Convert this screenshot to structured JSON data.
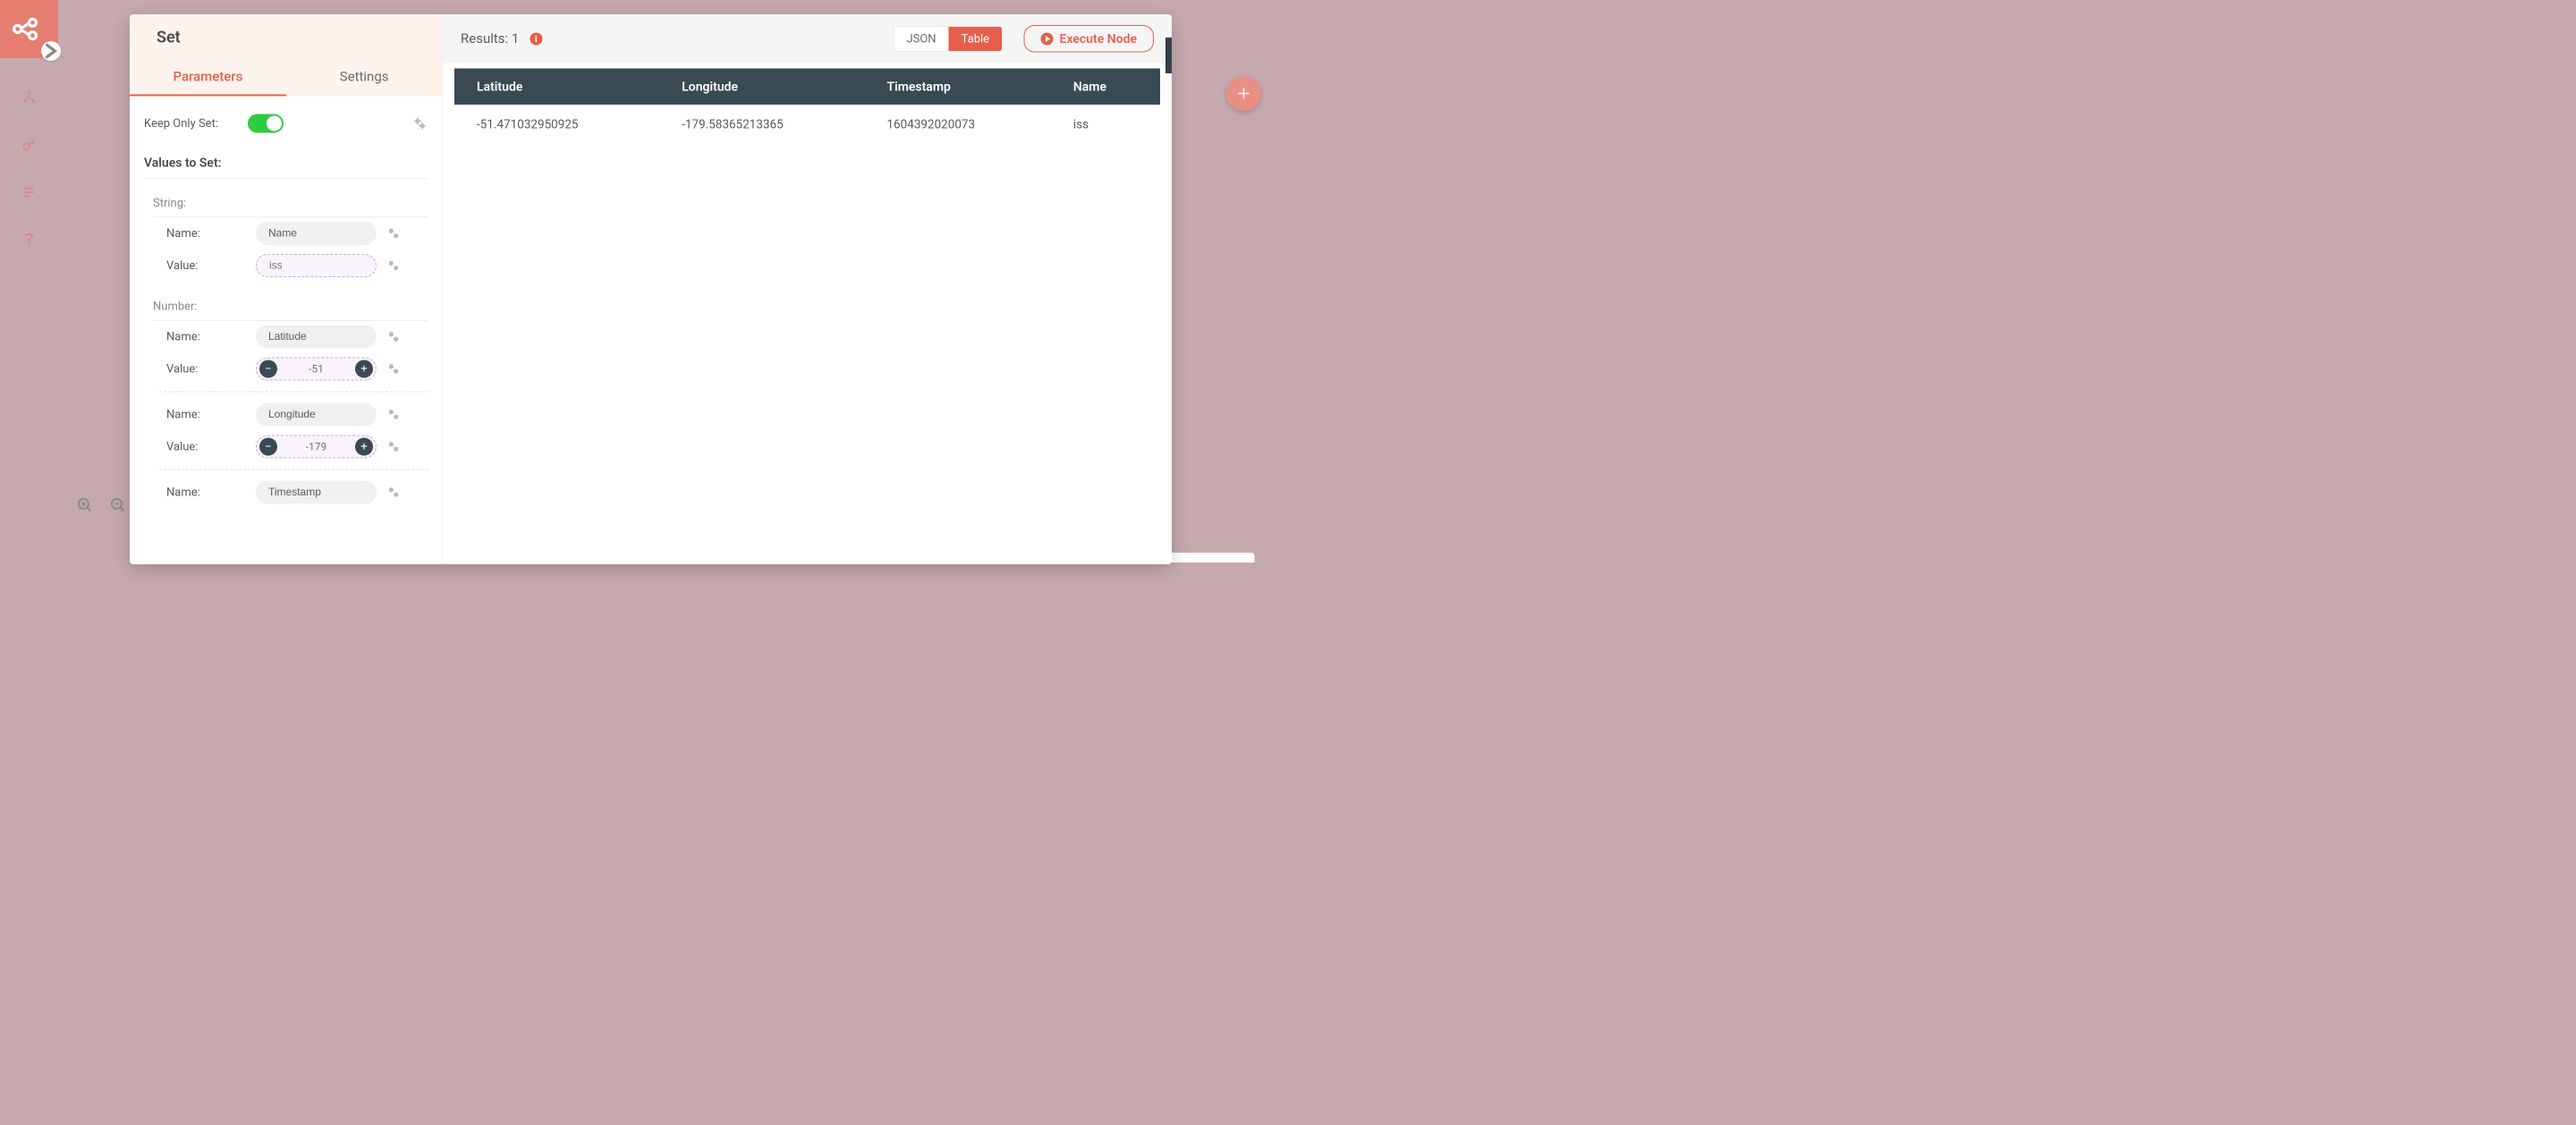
{
  "node": {
    "title": "Set"
  },
  "tabs": {
    "parameters": "Parameters",
    "settings": "Settings"
  },
  "params": {
    "keepOnlySet": {
      "label": "Keep Only Set:",
      "value": true
    },
    "valuesToSet": {
      "label": "Values to Set:"
    },
    "string": {
      "section": "String:",
      "items": [
        {
          "nameLabel": "Name:",
          "name": "Name",
          "valueLabel": "Value:",
          "value": "iss"
        }
      ]
    },
    "number": {
      "section": "Number:",
      "items": [
        {
          "nameLabel": "Name:",
          "name": "Latitude",
          "valueLabel": "Value:",
          "value": "-51"
        },
        {
          "nameLabel": "Name:",
          "name": "Longitude",
          "valueLabel": "Value:",
          "value": "-179"
        },
        {
          "nameLabel": "Name:",
          "name": "Timestamp"
        }
      ]
    }
  },
  "results": {
    "label": "Results: 1",
    "viewJSON": "JSON",
    "viewTable": "Table",
    "executeLabel": "Execute Node",
    "columns": [
      "Latitude",
      "Longitude",
      "Timestamp",
      "Name"
    ],
    "rows": [
      {
        "Latitude": "-51.471032950925",
        "Longitude": "-179.58365213365",
        "Timestamp": "1604392020073",
        "Name": "iss"
      }
    ]
  }
}
